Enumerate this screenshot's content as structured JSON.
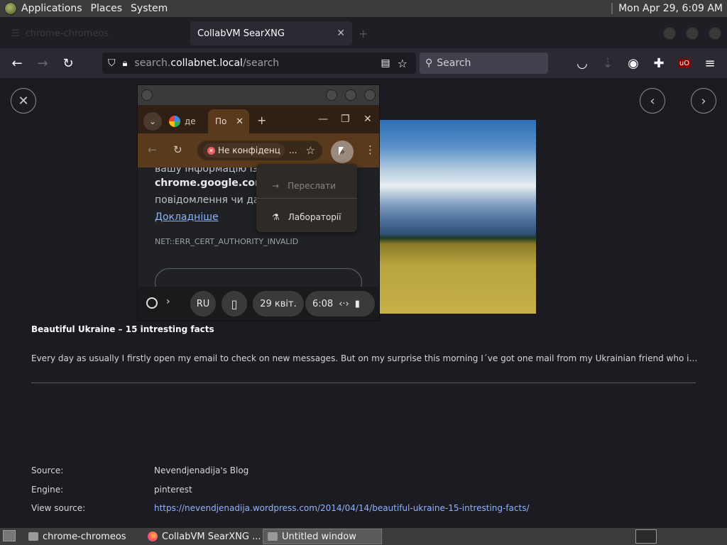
{
  "top_panel": {
    "menus": [
      "Applications",
      "Places",
      "System"
    ],
    "clock": "Mon Apr 29,  6:09 AM"
  },
  "firefox": {
    "ghost_tab_label": "chrome-chromeos",
    "active_tab_title": "CollabVM SearXNG",
    "url_prefix": "search.",
    "url_host": "collabnet.local",
    "url_path": "/search",
    "search_placeholder": "Search"
  },
  "result": {
    "title": "Beautiful Ukraine – 15 intresting facts",
    "description": "Every day as usually I firstly open my email to check on new messages. But on my surprise this morning I´ve got one mail from my Ukrainian friend who is now w…",
    "source_label": "Source:",
    "source_value": "Nevendjenadija's Blog",
    "engine_label": "Engine:",
    "engine_value": "pinterest",
    "view_source_label": "View source:",
    "view_source_url": "https://nevendjenadija.wordpress.com/2014/04/14/beautiful-ukraine-15-intresting-facts/"
  },
  "chromeos": {
    "tab1_label": "де",
    "tab2_label": "По",
    "omnibox_chip": "Не конфіденц",
    "omnibox_dots": "...",
    "content_line0": "вашу інформацію із сайт",
    "content_domain": "chrome.google.com",
    "content_domain_suffix": " (",
    "content_line2": "повідомлення чи дані",
    "content_link": "Докладніше",
    "error_code": "NET::ERR_CERT_AUTHORITY_INVALID",
    "menu": {
      "forward": "Переслати",
      "labs": "Лабораторії"
    },
    "shelf": {
      "ime": "RU",
      "date": "29 квіт.",
      "time": "6:08"
    }
  },
  "taskbar": {
    "tasks": [
      "chrome-chromeos",
      "CollabVM SearXNG ...",
      "Untitled window"
    ]
  }
}
